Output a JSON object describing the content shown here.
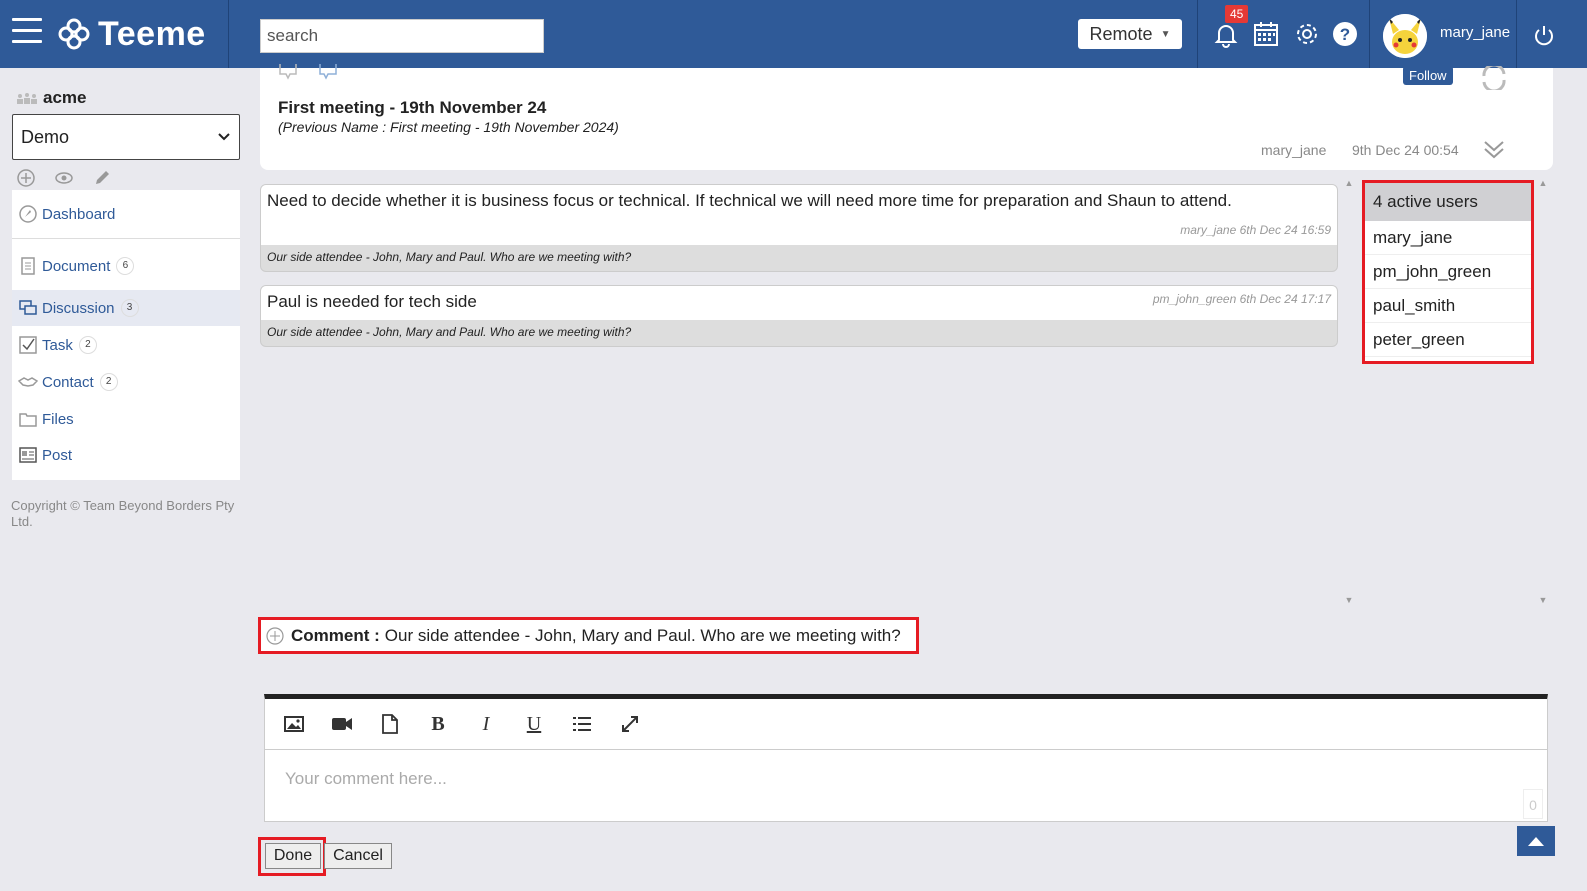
{
  "header": {
    "app_name": "Teeme",
    "search_placeholder": "search",
    "mode_label": "Remote",
    "notification_count": "45",
    "username": "mary_jane"
  },
  "sidebar": {
    "org": "acme",
    "project": "Demo",
    "items": [
      {
        "label": "Dashboard",
        "count": ""
      },
      {
        "label": "Document",
        "count": "6"
      },
      {
        "label": "Discussion",
        "count": "3"
      },
      {
        "label": "Task",
        "count": "2"
      },
      {
        "label": "Contact",
        "count": "2"
      },
      {
        "label": "Files",
        "count": ""
      },
      {
        "label": "Post",
        "count": ""
      }
    ],
    "copyright": "Copyright © Team Beyond Borders Pty Ltd."
  },
  "topic": {
    "title": "First meeting - 19th November 24",
    "previous_name": "(Previous Name   : First meeting - 19th November 2024)",
    "follow_label": "Follow",
    "author": "mary_jane",
    "date": "9th Dec 24 00:54"
  },
  "messages": [
    {
      "text": "Need to decide whether it is business focus or technical. If technical we will need more time for preparation and Shaun to attend.",
      "meta": "mary_jane 6th Dec 24 16:59",
      "foot": "Our side attendee - John, Mary and Paul. Who are we meeting with?"
    },
    {
      "text": "Paul is needed for tech side",
      "meta": "pm_john_green 6th Dec 24 17:17",
      "foot": "Our side attendee - John, Mary and Paul. Who are we meeting with?"
    }
  ],
  "active_users": {
    "heading": "4 active users",
    "users": [
      "mary_jane",
      "pm_john_green",
      "paul_smith",
      "peter_green"
    ]
  },
  "comment": {
    "label": "Comment :",
    "text": "Our side attendee - John, Mary and Paul. Who are we meeting with?"
  },
  "editor": {
    "placeholder": "Your comment here...",
    "char_count": "0",
    "toolbar": [
      "image-icon",
      "video-icon",
      "file-icon",
      "bold-icon",
      "italic-icon",
      "underline-icon",
      "list-icon",
      "fullscreen-icon"
    ]
  },
  "actions": {
    "done_label": "Done",
    "cancel_label": "Cancel"
  }
}
